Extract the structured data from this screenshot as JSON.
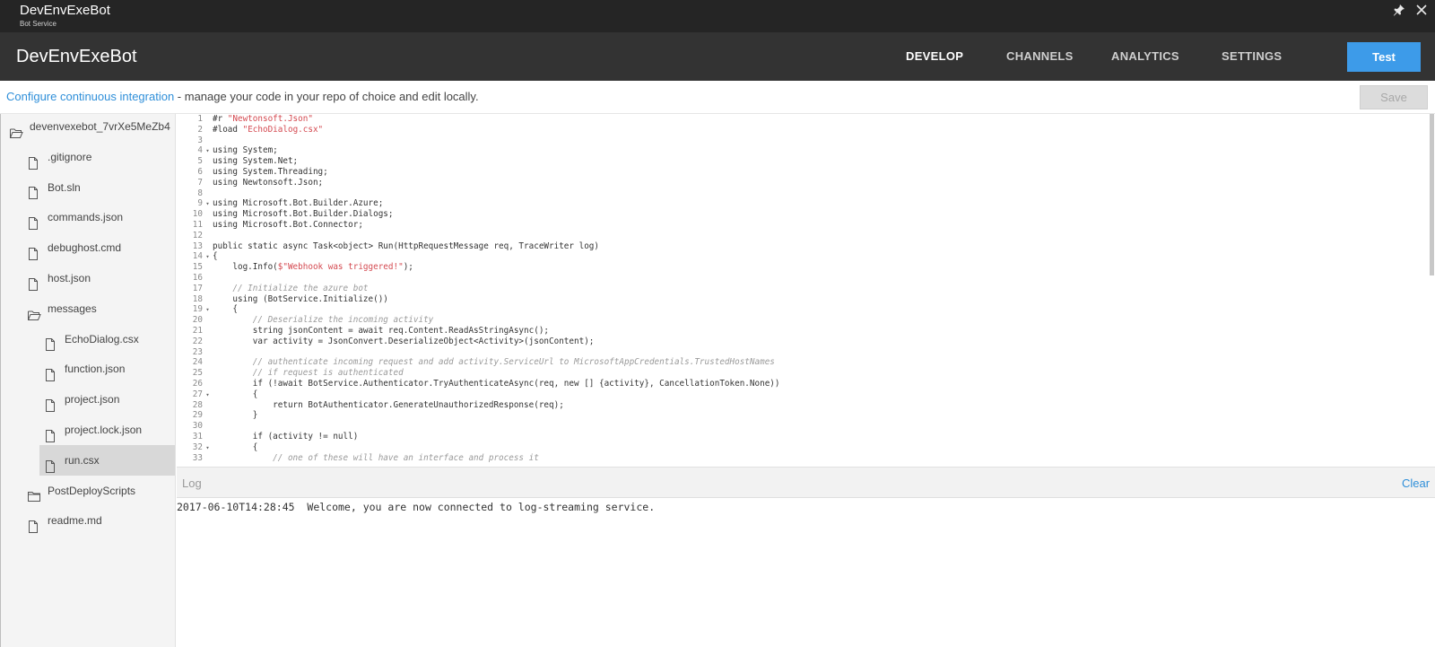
{
  "window": {
    "title": "DevEnvExeBot",
    "subtitle": "Bot Service",
    "pin_icon": "pin-icon",
    "close_icon": "close-icon"
  },
  "header": {
    "title": "DevEnvExeBot",
    "tabs": [
      {
        "label": "DEVELOP",
        "active": true
      },
      {
        "label": "CHANNELS",
        "active": false
      },
      {
        "label": "ANALYTICS",
        "active": false
      },
      {
        "label": "SETTINGS",
        "active": false
      }
    ],
    "test_label": "Test"
  },
  "ci": {
    "link_text": "Configure continuous integration",
    "rest_text": " - manage your code in your repo of choice and edit locally.",
    "save_label": "Save"
  },
  "colors": {
    "accent": "#3d9be9",
    "link": "#2f8fd9",
    "header_bg": "#333333",
    "titlebar_bg": "#252525"
  },
  "tree": [
    {
      "label": "devenvexebot_7vrXe5MeZb4",
      "type": "folder-open",
      "level": 0
    },
    {
      "label": ".gitignore",
      "type": "file",
      "level": 1
    },
    {
      "label": "Bot.sln",
      "type": "file",
      "level": 1
    },
    {
      "label": "commands.json",
      "type": "file",
      "level": 1
    },
    {
      "label": "debughost.cmd",
      "type": "file",
      "level": 1
    },
    {
      "label": "host.json",
      "type": "file",
      "level": 1
    },
    {
      "label": "messages",
      "type": "folder-open",
      "level": 1
    },
    {
      "label": "EchoDialog.csx",
      "type": "file",
      "level": 2
    },
    {
      "label": "function.json",
      "type": "file",
      "level": 2
    },
    {
      "label": "project.json",
      "type": "file",
      "level": 2
    },
    {
      "label": "project.lock.json",
      "type": "file",
      "level": 2
    },
    {
      "label": "run.csx",
      "type": "file",
      "level": 2,
      "selected": true
    },
    {
      "label": "PostDeployScripts",
      "type": "folder",
      "level": 1
    },
    {
      "label": "readme.md",
      "type": "file",
      "level": 1
    }
  ],
  "editor": {
    "lines": [
      {
        "n": "1",
        "fold": false,
        "parts": [
          [
            "#r ",
            ""
          ],
          [
            "\"Newtonsoft.Json\"",
            "str"
          ]
        ]
      },
      {
        "n": "2",
        "fold": false,
        "parts": [
          [
            "#load ",
            ""
          ],
          [
            "\"EchoDialog.csx\"",
            "str"
          ]
        ]
      },
      {
        "n": "3",
        "fold": false,
        "parts": []
      },
      {
        "n": "4",
        "fold": true,
        "parts": [
          [
            "using System;",
            ""
          ]
        ]
      },
      {
        "n": "5",
        "fold": false,
        "parts": [
          [
            "using System.Net;",
            ""
          ]
        ]
      },
      {
        "n": "6",
        "fold": false,
        "parts": [
          [
            "using System.Threading;",
            ""
          ]
        ]
      },
      {
        "n": "7",
        "fold": false,
        "parts": [
          [
            "using Newtonsoft.Json;",
            ""
          ]
        ]
      },
      {
        "n": "8",
        "fold": false,
        "parts": []
      },
      {
        "n": "9",
        "fold": true,
        "parts": [
          [
            "using Microsoft.Bot.Builder.Azure;",
            ""
          ]
        ]
      },
      {
        "n": "10",
        "fold": false,
        "parts": [
          [
            "using Microsoft.Bot.Builder.Dialogs;",
            ""
          ]
        ]
      },
      {
        "n": "11",
        "fold": false,
        "parts": [
          [
            "using Microsoft.Bot.Connector;",
            ""
          ]
        ]
      },
      {
        "n": "12",
        "fold": false,
        "parts": []
      },
      {
        "n": "13",
        "fold": false,
        "parts": [
          [
            "public static async Task<object> Run(HttpRequestMessage req, TraceWriter log)",
            ""
          ]
        ]
      },
      {
        "n": "14",
        "fold": true,
        "parts": [
          [
            "{",
            ""
          ]
        ]
      },
      {
        "n": "15",
        "fold": false,
        "parts": [
          [
            "    log.Info(",
            ""
          ],
          [
            "$\"Webhook was triggered!\"",
            "str"
          ],
          [
            ");",
            ""
          ]
        ]
      },
      {
        "n": "16",
        "fold": false,
        "parts": []
      },
      {
        "n": "17",
        "fold": false,
        "parts": [
          [
            "    // Initialize the azure bot",
            "cmt"
          ]
        ]
      },
      {
        "n": "18",
        "fold": false,
        "parts": [
          [
            "    using (BotService.Initialize())",
            ""
          ]
        ]
      },
      {
        "n": "19",
        "fold": true,
        "parts": [
          [
            "    {",
            ""
          ]
        ]
      },
      {
        "n": "20",
        "fold": false,
        "parts": [
          [
            "        // Deserialize the incoming activity",
            "cmt"
          ]
        ]
      },
      {
        "n": "21",
        "fold": false,
        "parts": [
          [
            "        string jsonContent = await req.Content.ReadAsStringAsync();",
            ""
          ]
        ]
      },
      {
        "n": "22",
        "fold": false,
        "parts": [
          [
            "        var activity = JsonConvert.DeserializeObject<Activity>(jsonContent);",
            ""
          ]
        ]
      },
      {
        "n": "23",
        "fold": false,
        "parts": []
      },
      {
        "n": "24",
        "fold": false,
        "parts": [
          [
            "        // authenticate incoming request and add activity.ServiceUrl to MicrosoftAppCredentials.TrustedHostNames",
            "cmt"
          ]
        ]
      },
      {
        "n": "25",
        "fold": false,
        "parts": [
          [
            "        // if request is authenticated",
            "cmt"
          ]
        ]
      },
      {
        "n": "26",
        "fold": false,
        "parts": [
          [
            "        if (!await BotService.Authenticator.TryAuthenticateAsync(req, new [] {activity}, CancellationToken.None))",
            ""
          ]
        ]
      },
      {
        "n": "27",
        "fold": true,
        "parts": [
          [
            "        {",
            ""
          ]
        ]
      },
      {
        "n": "28",
        "fold": false,
        "parts": [
          [
            "            return BotAuthenticator.GenerateUnauthorizedResponse(req);",
            ""
          ]
        ]
      },
      {
        "n": "29",
        "fold": false,
        "parts": [
          [
            "        }",
            ""
          ]
        ]
      },
      {
        "n": "30",
        "fold": false,
        "parts": []
      },
      {
        "n": "31",
        "fold": false,
        "parts": [
          [
            "        if (activity != null)",
            ""
          ]
        ]
      },
      {
        "n": "32",
        "fold": true,
        "parts": [
          [
            "        {",
            ""
          ]
        ]
      },
      {
        "n": "33",
        "fold": false,
        "parts": [
          [
            "            // one of these will have an interface and process it",
            "cmt"
          ]
        ]
      }
    ]
  },
  "log": {
    "title": "Log",
    "clear_label": "Clear",
    "line": "2017-06-10T14:28:45  Welcome, you are now connected to log-streaming service."
  }
}
